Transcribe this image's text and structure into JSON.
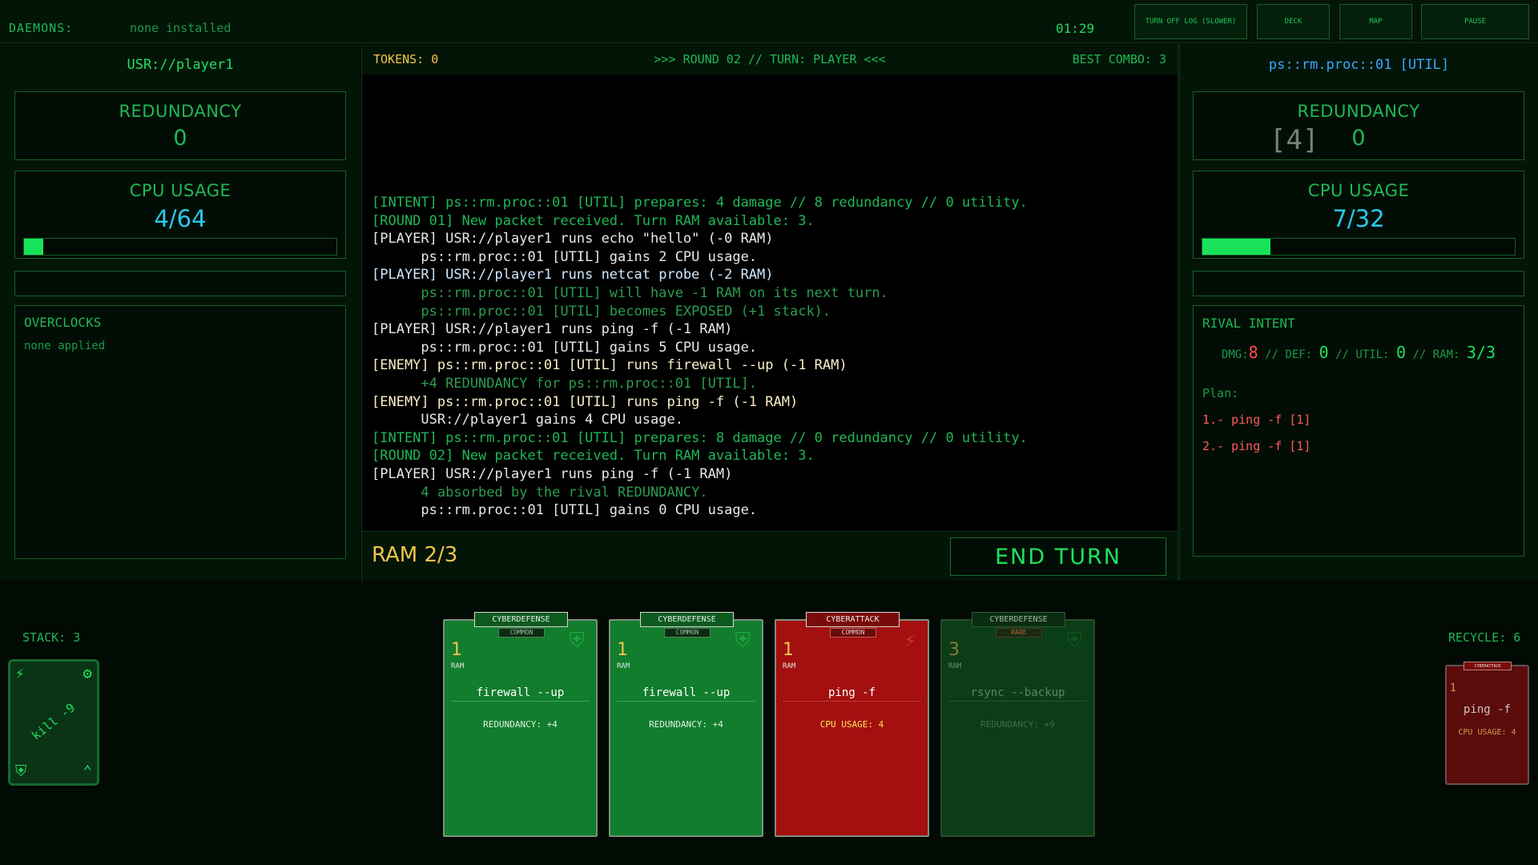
{
  "topbar": {
    "daemons_label": "DAEMONS:",
    "daemons_value": "none installed",
    "timer": "01:29",
    "buttons": {
      "log": "TURN OFF LOG (SLOWER)",
      "deck": "DECK",
      "map": "MAP",
      "pause": "PAUSE"
    }
  },
  "player": {
    "name": "USR://player1",
    "redundancy_label": "REDUNDANCY",
    "redundancy_value": "0",
    "cpu_label": "CPU USAGE",
    "cpu_value": "4/64",
    "cpu_fraction": 0.0625,
    "overclocks_label": "OVERCLOCKS",
    "overclocks_value": "none applied"
  },
  "center": {
    "tokens": "TOKENS: 0",
    "round": ">>> ROUND 02 // TURN: PLAYER <<<",
    "best_combo": "BEST COMBO: 3",
    "log": [
      {
        "text": "[INTENT] ps::rm.proc::01 [UTIL] prepares: 4 damage // 8 redundancy // 0 utility.",
        "kind": "info"
      },
      {
        "text": "[ROUND 01] New packet received. Turn RAM available: 3.",
        "kind": "info"
      },
      {
        "text": "[PLAYER] USR://player1 runs echo \"hello\" (-0 RAM)",
        "kind": "player"
      },
      {
        "text": "      ps::rm.proc::01 [UTIL] gains 2 CPU usage.",
        "kind": "subw"
      },
      {
        "text": "[PLAYER] USR://player1 runs netcat probe (-2 RAM)",
        "kind": "netcat"
      },
      {
        "text": "      ps::rm.proc::01 [UTIL] will have -1 RAM on its next turn.",
        "kind": "sub"
      },
      {
        "text": "      ps::rm.proc::01 [UTIL] becomes EXPOSED (+1 stack).",
        "kind": "sub"
      },
      {
        "text": "[PLAYER] USR://player1 runs ping -f (-1 RAM)",
        "kind": "player"
      },
      {
        "text": "      ps::rm.proc::01 [UTIL] gains 5 CPU usage.",
        "kind": "subw"
      },
      {
        "text": "[ENEMY] ps::rm.proc::01 [UTIL] runs firewall --up (-1 RAM)",
        "kind": "enemy"
      },
      {
        "text": "      +4 REDUNDANCY for ps::rm.proc::01 [UTIL].",
        "kind": "sub"
      },
      {
        "text": "[ENEMY] ps::rm.proc::01 [UTIL] runs ping -f (-1 RAM)",
        "kind": "enemy"
      },
      {
        "text": "      USR://player1 gains 4 CPU usage.",
        "kind": "subw"
      },
      {
        "text": "[INTENT] ps::rm.proc::01 [UTIL] prepares: 8 damage // 0 redundancy // 0 utility.",
        "kind": "info"
      },
      {
        "text": "[ROUND 02] New packet received. Turn RAM available: 3.",
        "kind": "info"
      },
      {
        "text": "[PLAYER] USR://player1 runs ping -f (-1 RAM)",
        "kind": "player"
      },
      {
        "text": "      4 absorbed by the rival REDUNDANCY.",
        "kind": "sub"
      },
      {
        "text": "      ps::rm.proc::01 [UTIL] gains 0 CPU usage.",
        "kind": "subw"
      }
    ],
    "ram": "RAM 2/3",
    "end_turn": "END TURN"
  },
  "rival": {
    "name": "ps::rm.proc::01 [UTIL]",
    "redundancy_label": "REDUNDANCY",
    "redundancy_value": "0",
    "redundancy_popup": "[4]",
    "cpu_label": "CPU USAGE",
    "cpu_value": "7/32",
    "cpu_fraction": 0.21875,
    "intent_label": "RIVAL INTENT",
    "intent": {
      "dmg_label": "DMG:",
      "dmg": "8",
      "def_label": "DEF:",
      "def": "0",
      "util_label": "UTIL:",
      "util": "0",
      "ram_label": "RAM:",
      "ram": "3/3",
      "sep": "//"
    },
    "plan_label": "Plan:",
    "plan": [
      "1.- ping -f [1]",
      "2.- ping -f [1]"
    ]
  },
  "hand": {
    "stack_label": "STACK: 3",
    "recycle_label": "RECYCLE: 6",
    "deck_card_name": "kill -9",
    "cards": [
      {
        "type": "CYBERDEFENSE",
        "rarity": "COMMON",
        "cost": "1",
        "cost_label": "RAM",
        "name": "firewall --up",
        "effect": "REDUNDANCY: +4",
        "style": "def",
        "emblem": "shield-icon"
      },
      {
        "type": "CYBERDEFENSE",
        "rarity": "COMMON",
        "cost": "1",
        "cost_label": "RAM",
        "name": "firewall --up",
        "effect": "REDUNDANCY: +4",
        "style": "def",
        "emblem": "shield-icon"
      },
      {
        "type": "CYBERATTACK",
        "rarity": "COMMON",
        "cost": "1",
        "cost_label": "RAM",
        "name": "ping -f",
        "effect": "CPU USAGE: 4",
        "style": "atk",
        "emblem": "lightning-icon"
      },
      {
        "type": "CYBERDEFENSE",
        "rarity": "RARE",
        "cost": "3",
        "cost_label": "RAM",
        "name": "rsync --backup",
        "effect": "REDUNDANCY: +9",
        "style": "rare",
        "emblem": "shield-icon"
      }
    ],
    "recycle_card": {
      "type": "CYBERATTACK",
      "cost": "1",
      "name": "ping -f",
      "effect": "CPU USAGE: 4"
    }
  },
  "colors": {
    "accent_green": "#1fb855",
    "bright_green": "#1fe160",
    "cpu_cyan": "#29c8ee",
    "gold": "#f0c44c",
    "danger_red": "#ff4d4d",
    "attack_card": "#a3100f",
    "defense_card": "#117d2d"
  }
}
